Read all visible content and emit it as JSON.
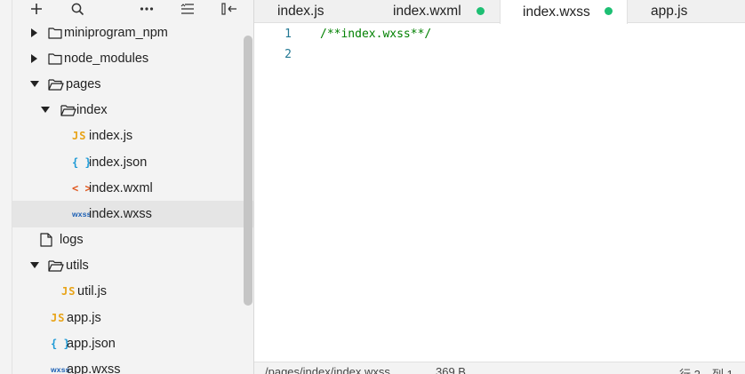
{
  "sidebar": {
    "toolbar": {
      "add_icon": "plus-icon",
      "search_icon": "search-icon",
      "more_icon": "more-icon",
      "collapse_icon": "collapse-all-icon",
      "hide_icon": "hide-sidebar-icon"
    },
    "tree": [
      {
        "label": "miniprogram_npm",
        "type": "folder",
        "expanded": false
      },
      {
        "label": "node_modules",
        "type": "folder",
        "expanded": false
      },
      {
        "label": "pages",
        "type": "folder",
        "expanded": true
      },
      {
        "label": "index",
        "type": "folder",
        "expanded": true
      },
      {
        "label": "index.js",
        "type": "js",
        "icon_text": "JS"
      },
      {
        "label": "index.json",
        "type": "json",
        "icon_text": "{ }"
      },
      {
        "label": "index.wxml",
        "type": "wxml",
        "icon_text": "< >"
      },
      {
        "label": "index.wxss",
        "type": "wxss",
        "icon_text": "wxss",
        "selected": true
      },
      {
        "label": "logs",
        "type": "folder",
        "expanded": false
      },
      {
        "label": "utils",
        "type": "folder",
        "expanded": true
      },
      {
        "label": "util.js",
        "type": "js",
        "icon_text": "JS"
      },
      {
        "label": "app.js",
        "type": "js",
        "icon_text": "JS"
      },
      {
        "label": "app.json",
        "type": "json",
        "icon_text": "{ }"
      },
      {
        "label": "app.wxss",
        "type": "wxss",
        "icon_text": "wxss"
      }
    ]
  },
  "editor": {
    "tabs": [
      {
        "label": "index.js",
        "modified": false,
        "active": false
      },
      {
        "label": "index.wxml",
        "modified": true,
        "active": false
      },
      {
        "label": "index.wxss",
        "modified": true,
        "active": true
      },
      {
        "label": "app.js",
        "modified": false,
        "active": false
      }
    ],
    "lines": [
      {
        "num": "1",
        "text": "/**index.wxss**/"
      },
      {
        "num": "2",
        "text": ""
      }
    ],
    "status": {
      "path": "/pages/index/index.wxss",
      "size": "369 B",
      "position": "行 2，列 1"
    }
  },
  "colors": {
    "modified_dot": "#1dbf73",
    "comment": "#008000",
    "line_number": "#237893",
    "js_icon": "#e8a317",
    "json_icon": "#1e9ad6",
    "wxml_icon": "#e0561c",
    "wxss_icon": "#1b5fb4"
  }
}
